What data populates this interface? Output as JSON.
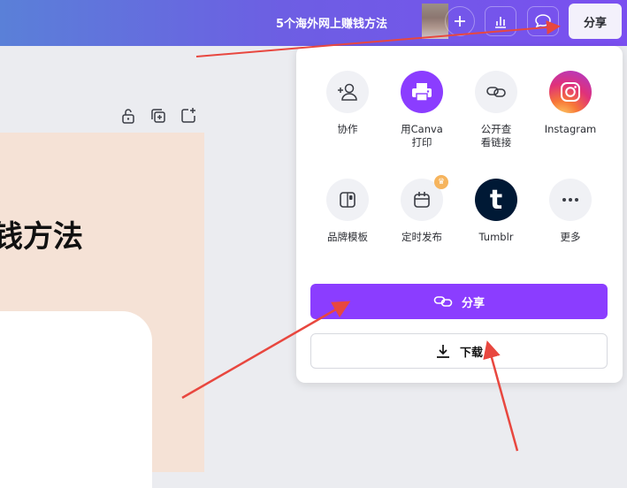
{
  "topbar": {
    "doc_title": "5个海外网上赚钱方法",
    "share_label": "分享",
    "icons": [
      "plus-icon",
      "bar-chart-icon",
      "comment-icon"
    ]
  },
  "canvas": {
    "page_title": "钱方法",
    "page_action_icons": [
      "lock-icon",
      "duplicate-icon",
      "add-page-icon"
    ]
  },
  "share_panel": {
    "options": [
      {
        "label": "协作",
        "icon": "collaborate-icon"
      },
      {
        "label": "用Canva\n打印",
        "icon": "printer-icon"
      },
      {
        "label": "公开查\n看链接",
        "icon": "link-icon"
      },
      {
        "label": "Instagram",
        "icon": "instagram-icon"
      },
      {
        "label": "品牌模板",
        "icon": "brand-template-icon"
      },
      {
        "label": "定时发布",
        "icon": "calendar-icon"
      },
      {
        "label": "Tumblr",
        "icon": "tumblr-icon"
      },
      {
        "label": "更多",
        "icon": "more-icon"
      }
    ],
    "share_button": "分享",
    "download_button": "下载"
  },
  "colors": {
    "accent": "#8b3dff",
    "topbar_start": "#5a80d8",
    "topbar_end": "#7a4ff0",
    "annotation_arrow": "#e8473f",
    "page_bg": "#f5e2d6"
  }
}
